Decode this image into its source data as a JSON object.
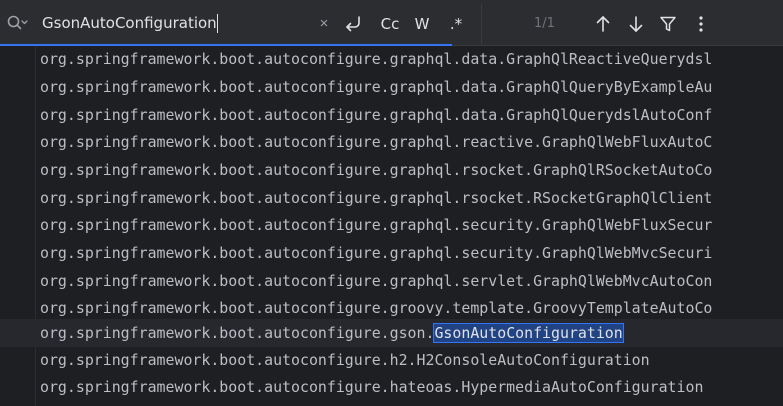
{
  "search": {
    "query": "GsonAutoConfiguration",
    "clear_label": "×",
    "regex_options": {
      "newline_label": "↵",
      "match_case_label": "Cc",
      "words_label": "W",
      "regex_label": ".*"
    },
    "match_count": "1/1"
  },
  "code": {
    "lines": [
      "org.springframework.boot.autoconfigure.graphql.data.GraphQlReactiveQuerydsl",
      "org.springframework.boot.autoconfigure.graphql.data.GraphQlQueryByExampleAu",
      "org.springframework.boot.autoconfigure.graphql.data.GraphQlQuerydslAutoConf",
      "org.springframework.boot.autoconfigure.graphql.reactive.GraphQlWebFluxAutoC",
      "org.springframework.boot.autoconfigure.graphql.rsocket.GraphQlRSocketAutoCo",
      "org.springframework.boot.autoconfigure.graphql.rsocket.RSocketGraphQlClient",
      "org.springframework.boot.autoconfigure.graphql.security.GraphQlWebFluxSecur",
      "org.springframework.boot.autoconfigure.graphql.security.GraphQlWebMvcSecuri",
      "org.springframework.boot.autoconfigure.graphql.servlet.GraphQlWebMvcAutoCon",
      "org.springframework.boot.autoconfigure.groovy.template.GroovyTemplateAutoCo"
    ],
    "current_line_prefix": "org.springframework.boot.autoconfigure.gson.",
    "current_line_match": "GsonAutoConfiguration",
    "after_lines": [
      "org.springframework.boot.autoconfigure.h2.H2ConsoleAutoConfiguration",
      "org.springframework.boot.autoconfigure.hateoas.HypermediaAutoConfiguration"
    ]
  },
  "colors": {
    "background": "#1e1f22",
    "toolbar": "#2b2d30",
    "match_highlight": "#214283",
    "accent": "#3574f0"
  },
  "icons": [
    "search-icon",
    "clear-icon",
    "newline-icon",
    "match-case-icon",
    "words-icon",
    "regex-icon",
    "prev-occurrence-icon",
    "next-occurrence-icon",
    "filter-icon",
    "more-icon"
  ]
}
